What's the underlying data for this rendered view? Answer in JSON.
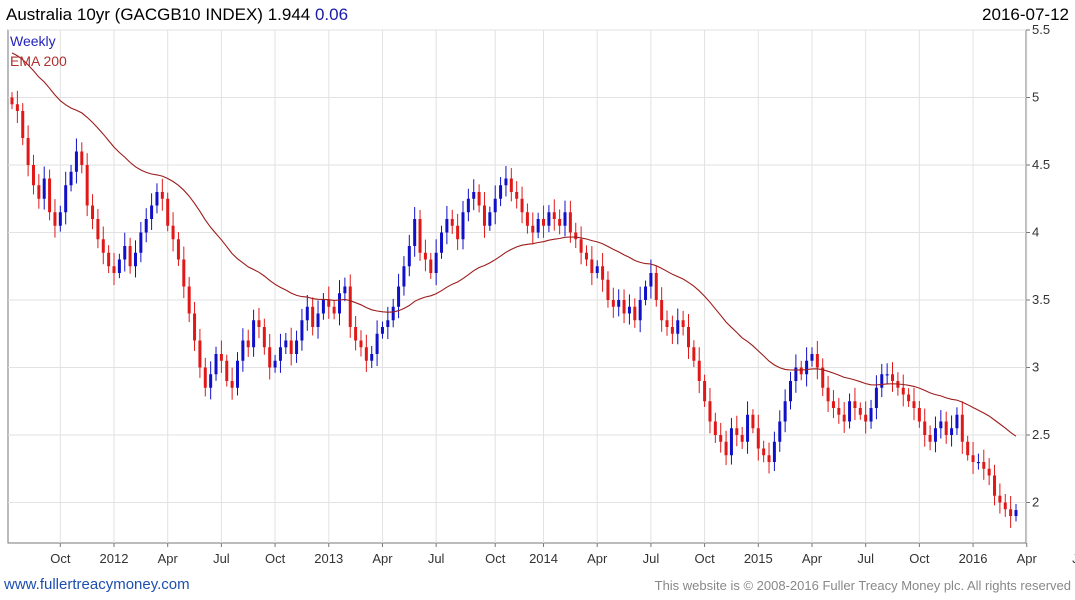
{
  "header": {
    "title": "Australia 10yr (GACGB10 INDEX) 1.944",
    "change": "0.06",
    "date": "2016-07-12"
  },
  "legend": {
    "period": "Weekly",
    "indicator": "EMA 200"
  },
  "footer": {
    "site": "www.fullertreacymoney.com",
    "copyright": "This website is © 2008-2016 Fuller Treacy Money plc. All rights reserved"
  },
  "colors": {
    "up": "#1010c8",
    "down": "#e01818",
    "ema": "#9b1c1c",
    "grid": "#e2e2e2"
  },
  "chart_data": {
    "type": "candlestick",
    "ylim": [
      1.7,
      5.5
    ],
    "yticks": [
      2,
      2.5,
      3,
      3.5,
      4,
      4.5,
      5,
      5.5
    ],
    "grid": true,
    "axis_side": "right",
    "x_tick_labels": [
      "Oct",
      "2012",
      "Apr",
      "Jul",
      "Oct",
      "2013",
      "Apr",
      "Jul",
      "Oct",
      "2014",
      "Apr",
      "Jul",
      "Oct",
      "2015",
      "Apr",
      "Jul",
      "Oct",
      "2016",
      "Apr",
      "Jul"
    ],
    "x_tick_weeks": [
      9,
      19,
      29,
      39,
      49,
      59,
      69,
      79,
      90,
      99,
      109,
      119,
      129,
      139,
      149,
      159,
      169,
      179,
      189,
      199
    ],
    "weekly_close": [
      4.95,
      4.9,
      4.7,
      4.5,
      4.35,
      4.25,
      4.4,
      4.15,
      4.05,
      4.15,
      4.35,
      4.45,
      4.6,
      4.5,
      4.2,
      4.1,
      3.95,
      3.85,
      3.75,
      3.7,
      3.8,
      3.9,
      3.75,
      3.85,
      4.0,
      4.1,
      4.2,
      4.3,
      4.25,
      4.05,
      3.95,
      3.8,
      3.6,
      3.4,
      3.2,
      3.0,
      2.85,
      2.95,
      3.1,
      3.05,
      2.9,
      2.85,
      3.05,
      3.2,
      3.15,
      3.35,
      3.3,
      3.15,
      3.0,
      3.05,
      3.15,
      3.2,
      3.1,
      3.2,
      3.35,
      3.45,
      3.3,
      3.4,
      3.5,
      3.45,
      3.4,
      3.55,
      3.6,
      3.3,
      3.2,
      3.15,
      3.05,
      3.1,
      3.25,
      3.3,
      3.35,
      3.45,
      3.6,
      3.75,
      3.9,
      4.1,
      3.85,
      3.8,
      3.7,
      3.85,
      4.0,
      4.1,
      4.05,
      3.95,
      4.15,
      4.25,
      4.3,
      4.2,
      4.05,
      4.15,
      4.25,
      4.35,
      4.4,
      4.3,
      4.25,
      4.15,
      4.05,
      4.0,
      4.1,
      4.05,
      4.15,
      4.1,
      4.05,
      4.15,
      4.0,
      3.95,
      3.85,
      3.8,
      3.7,
      3.75,
      3.65,
      3.5,
      3.45,
      3.5,
      3.4,
      3.45,
      3.35,
      3.5,
      3.6,
      3.7,
      3.5,
      3.35,
      3.3,
      3.25,
      3.35,
      3.3,
      3.15,
      3.05,
      2.9,
      2.75,
      2.6,
      2.5,
      2.45,
      2.35,
      2.55,
      2.5,
      2.45,
      2.65,
      2.55,
      2.4,
      2.35,
      2.3,
      2.45,
      2.6,
      2.75,
      2.9,
      3.0,
      2.95,
      3.05,
      3.1,
      3.0,
      2.85,
      2.75,
      2.7,
      2.65,
      2.6,
      2.75,
      2.7,
      2.65,
      2.6,
      2.7,
      2.85,
      2.95,
      2.95,
      2.9,
      2.85,
      2.8,
      2.75,
      2.7,
      2.6,
      2.5,
      2.45,
      2.55,
      2.6,
      2.5,
      2.55,
      2.65,
      2.45,
      2.35,
      2.3,
      2.3,
      2.25,
      2.2,
      2.05,
      2.0,
      1.95,
      1.9,
      1.944
    ]
  }
}
